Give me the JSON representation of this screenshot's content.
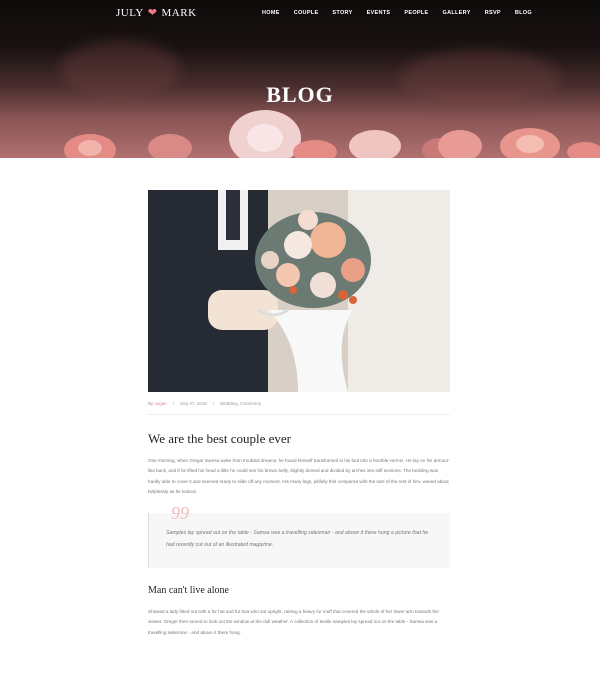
{
  "brand": {
    "left": "JULY",
    "right": "MARK",
    "heart_icon": "heart-icon",
    "heart_color": "#f07a82"
  },
  "nav": {
    "items": [
      "HOME",
      "COUPLE",
      "STORY",
      "EVENTS",
      "PEOPLE",
      "GALLERY",
      "RSVP",
      "BLOG"
    ]
  },
  "hero": {
    "title": "BLOG"
  },
  "post": {
    "meta": {
      "by": "By",
      "author": "vegan",
      "separator": "/",
      "date": "Sep 07, 2016",
      "categories": "Wedding, Ceremony"
    },
    "title": "We are the best couple ever",
    "intro": "One morning, when Gregor Samsa woke from troubled dreams, he found himself transformed in his bed into a horrible vermin. He lay on his armour-like back, and if he lifted his head a little he could see his brown belly, slightly domed and divided by arches into stiff sections. The bedding was hardly able to cover it and seemed ready to slide off any moment. His many legs, pitifully thin compared with the size of the rest of him, waved about helplessly as he looked.",
    "quote_mark": "99",
    "quote": "Samples lay spread out on the table - Samsa was a travelling salesman - and above it there hung a picture that he had recently cut out of an illustrated magazine.",
    "subheading": "Man can't live alone",
    "second": "Showed a lady fitted out with a fur hat and fur boa who sat upright, raising a heavy fur muff that covered the whole of her lower arm towards the viewer. Gregor then turned to look out the window at the dull weather. A collection of textile samples lay spread out on the table - Samsa was a travelling salesman - and above it there hung."
  },
  "colors": {
    "accent": "#e38a90",
    "hero_top": "#0d0a0a",
    "hero_bottom": "#b07070"
  }
}
